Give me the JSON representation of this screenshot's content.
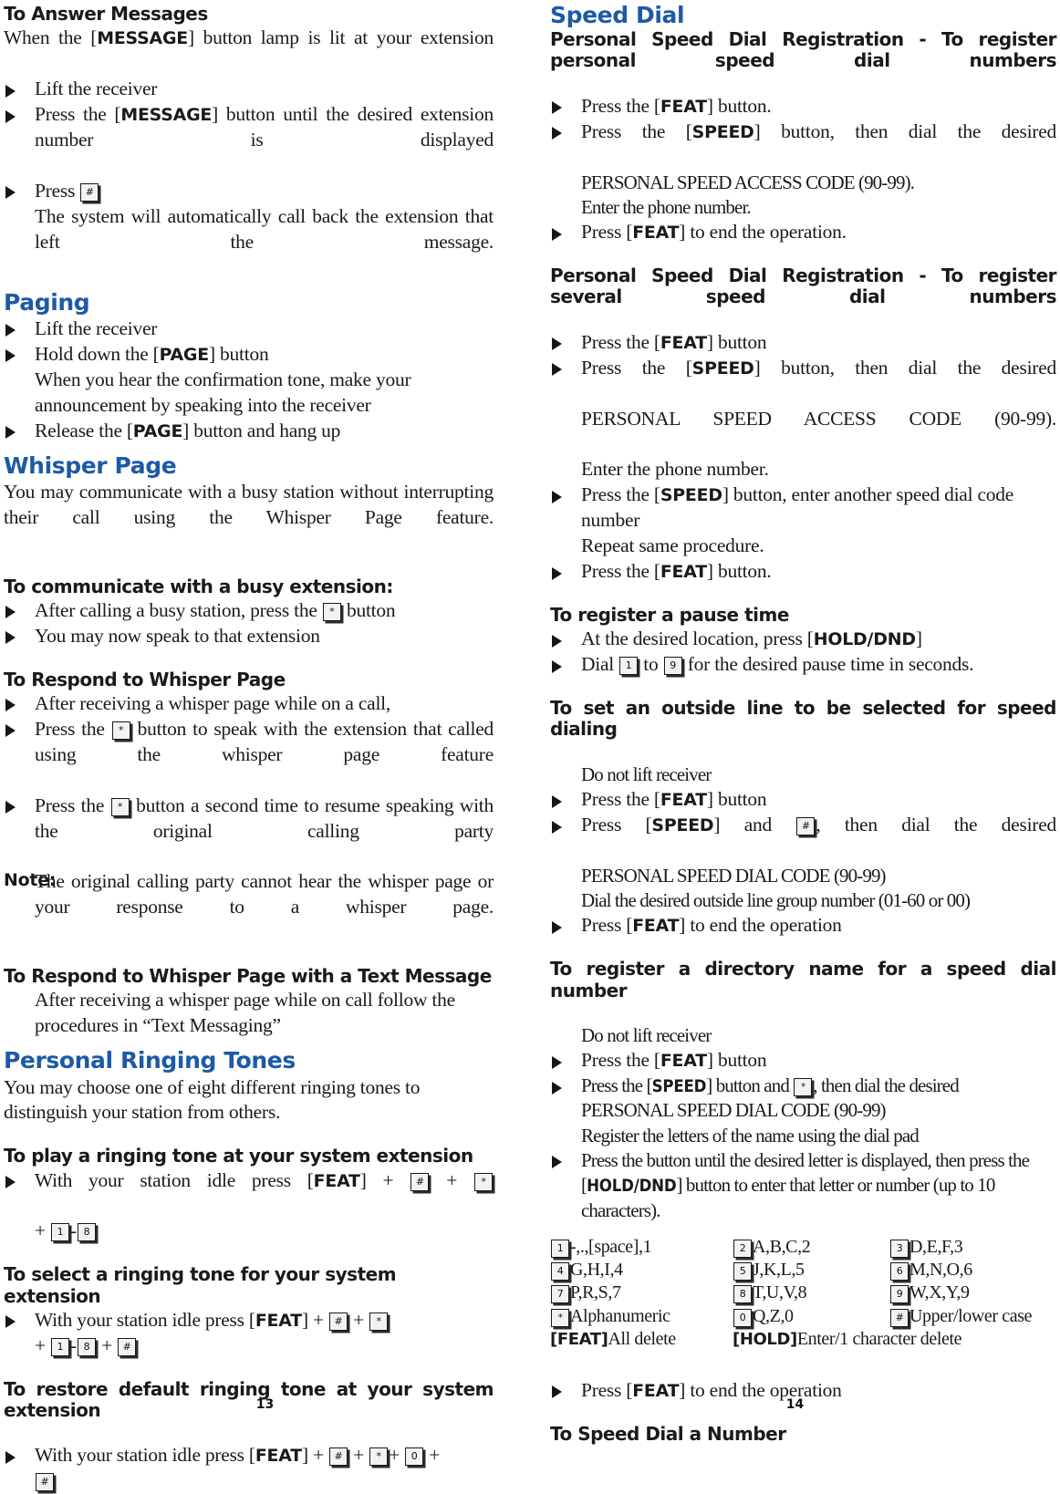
{
  "document": {
    "left_page_number": "13",
    "right_page_number": "14",
    "accent_color": "#1d5aa6"
  },
  "left_column": {
    "answer_messages": {
      "heading": "To Answer Messages",
      "intro_a": "When the [",
      "intro_b": "MESSAGE",
      "intro_c": "] button lamp is lit at your extension",
      "b1": "Lift the receiver",
      "b2_a": "Press the [",
      "b2_b": "MESSAGE",
      "b2_c": "] button until the desired extension number is displayed",
      "b3_a": "Press",
      "b3_key": "#",
      "b3_cont": "The system will automatically call back the extension that left the message."
    },
    "paging": {
      "heading": "Paging",
      "b1": "Lift the receiver",
      "b2_a": "Hold down the [",
      "b2_b": "PAGE",
      "b2_c": "] button",
      "b3": "When you hear the confirmation tone, make your announcement by speaking into the receiver",
      "b4_a": "Release the [",
      "b4_b": "PAGE",
      "b4_c": "] button and hang up"
    },
    "whisper_page": {
      "heading": "Whisper Page",
      "intro": "You may communicate with a busy station without interrupting their call using the Whisper Page feature.",
      "busy_heading": "To communicate with a busy extension:",
      "busy_b1_a": "After calling a busy station, press the",
      "busy_b1_key": "*",
      "busy_b1_b": "button",
      "busy_b2": "You may now speak to that extension",
      "respond_heading": "To Respond to Whisper Page",
      "r_b1": "After receiving a whisper page while on a call,",
      "r_b2_a": "Press the",
      "r_b2_key": "*",
      "r_b2_b": "button to speak with the extension that called using the whisper page feature",
      "r_b3_a": "Press the",
      "r_b3_key": "*",
      "r_b3_b": "button a second time to resume speaking with the original calling party",
      "note_label": "Note:",
      "note_text": "The original calling party cannot hear the whisper page or your response to a whisper page.",
      "text_msg_heading": "To Respond to Whisper Page with a Text Message",
      "t_b1": "After receiving a whisper page while on call follow the procedures in “Text Messaging”"
    },
    "ringing_tones": {
      "heading": "Personal Ringing Tones",
      "intro": "You may choose one of eight different ringing tones to distinguish your station from others.",
      "play_heading": "To play a ringing tone at your system extension",
      "play_a": "With your station idle press [",
      "play_feat": "FEAT",
      "play_b": "] +",
      "play_k1": "#",
      "play_plus": "+",
      "play_k2": "*",
      "play_line2_plus": "+",
      "play_k3": "1",
      "play_dash": "-",
      "play_k4": "8",
      "select_heading": "To select a ringing tone for your system extension",
      "select_a": "With your station idle press [",
      "select_feat": "FEAT",
      "select_b": "] +",
      "select_k1": "#",
      "select_plus": "+",
      "select_k2": "*",
      "select_k3": "1",
      "select_dash": "-",
      "select_k4": "8",
      "select_plus2": "+",
      "select_k5": "#",
      "restore_heading": "To restore default ringing tone at your system extension",
      "restore_a": "With your station idle press [",
      "restore_feat": "FEAT",
      "restore_b": "] +",
      "restore_k1": "#",
      "restore_plus": "+",
      "restore_k2": "*",
      "restore_plus2": "+",
      "restore_k3": "0",
      "restore_plus3": "+",
      "restore_k4": "#"
    }
  },
  "right_column": {
    "speed_dial": {
      "heading": "Speed Dial",
      "reg_heading": "Personal Speed Dial Registration - To register personal speed dial numbers",
      "r_b1_a": "Press the [",
      "r_b1_feat": "FEAT",
      "r_b1_b": "] button.",
      "r_b2_a": "Press the [",
      "r_b2_speed": "SPEED",
      "r_b2_b": "] button, then dial the desired",
      "r_b2_cont": "PERSONAL SPEED ACCESS CODE (90-99).",
      "r_b3": "Enter the phone number.",
      "r_b4_a": "Press [",
      "r_b4_feat": "FEAT",
      "r_b4_b": "] to end the operation.",
      "several_heading": "Personal Speed Dial Registration - To register several speed dial numbers",
      "s_b1_a": "Press the [",
      "s_b1_feat": "FEAT",
      "s_b1_b": "] button",
      "s_b2_a": "Press the [",
      "s_b2_speed": "SPEED",
      "s_b2_b": "] button, then dial the desired",
      "s_b2_cont": "PERSONAL SPEED ACCESS CODE (90-99).",
      "s_b3": "Enter the phone number.",
      "s_b4_a": "Press the [",
      "s_b4_speed": "SPEED",
      "s_b4_b": "] button, enter another speed dial code number",
      "s_b5": "Repeat same procedure.",
      "s_b6_a": "Press the [",
      "s_b6_feat": "FEAT",
      "s_b6_b": "] button.",
      "pause_heading": "To register a pause time",
      "p_b1_a": "At the desired location, press [",
      "p_b1_hold": "HOLD/DND",
      "p_b1_b": "]",
      "p_b2_a": "Dial",
      "p_b2_k1": "1",
      "p_b2_mid": "to",
      "p_b2_k2": "9",
      "p_b2_b": "for the desired pause time in seconds.",
      "outside_heading": "To set an outside line to be selected for speed dialing",
      "o_b1": "Do not lift receiver",
      "o_b2_a": "Press the [",
      "o_b2_feat": "FEAT",
      "o_b2_b": "] button",
      "o_b3_a": "Press [",
      "o_b3_speed": "SPEED",
      "o_b3_b": "] and",
      "o_b3_key": "#",
      "o_b3_c": ", then dial the desired",
      "o_b3_cont": "PERSONAL SPEED DIAL CODE (90-99)",
      "o_b4": "Dial the desired outside line group number (01-60 or 00)",
      "o_b5_a": "Press [",
      "o_b5_feat": "FEAT",
      "o_b5_b": "] to end the operation",
      "dir_heading": "To register a directory name for a speed dial number",
      "d_b1": "Do not lift receiver",
      "d_b2_a": "Press the [",
      "d_b2_feat": "FEAT",
      "d_b2_b": "] button",
      "d_b3_a": "Press the [",
      "d_b3_speed": "SPEED",
      "d_b3_b": "] button and",
      "d_b3_key": "*",
      "d_b3_c": ", then dial the desired",
      "d_b3_cont": "PERSONAL SPEED DIAL CODE (90-99)",
      "d_b4": "Register the letters of the name using the dial pad",
      "d_b5_a": "Press the button until the desired letter is displayed, then press the [",
      "d_b5_hold": "HOLD/DND",
      "d_b5_b": "] button to enter that letter or number (up to 10 characters).",
      "end_b_a": "Press [",
      "end_b_feat": "FEAT",
      "end_b_b": "] to end the operation",
      "speed_dial_number_heading": "To Speed Dial a Number"
    },
    "letter_map": {
      "rows": [
        [
          {
            "key": "1",
            "text": "-,.,[space],1"
          },
          {
            "key": "2",
            "text": "A,B,C,2"
          },
          {
            "key": "3",
            "text": "D,E,F,3"
          }
        ],
        [
          {
            "key": "4",
            "text": "G,H,I,4"
          },
          {
            "key": "5",
            "text": "J,K,L,5"
          },
          {
            "key": "6",
            "text": "M,N,O,6"
          }
        ],
        [
          {
            "key": "7",
            "text": "P,R,S,7"
          },
          {
            "key": "8",
            "text": "T,U,V,8"
          },
          {
            "key": "9",
            "text": "W,X,Y,9"
          }
        ],
        [
          {
            "key": "*",
            "text": "Alphanumeric"
          },
          {
            "key": "0",
            "text": "Q,Z,0"
          },
          {
            "key": "#",
            "text": "Upper/lower case"
          }
        ]
      ],
      "footer": {
        "feat_label": "[FEAT]",
        "feat_text": "All delete",
        "hold_label": "[HOLD]",
        "hold_text": "Enter/1 character delete"
      }
    }
  }
}
